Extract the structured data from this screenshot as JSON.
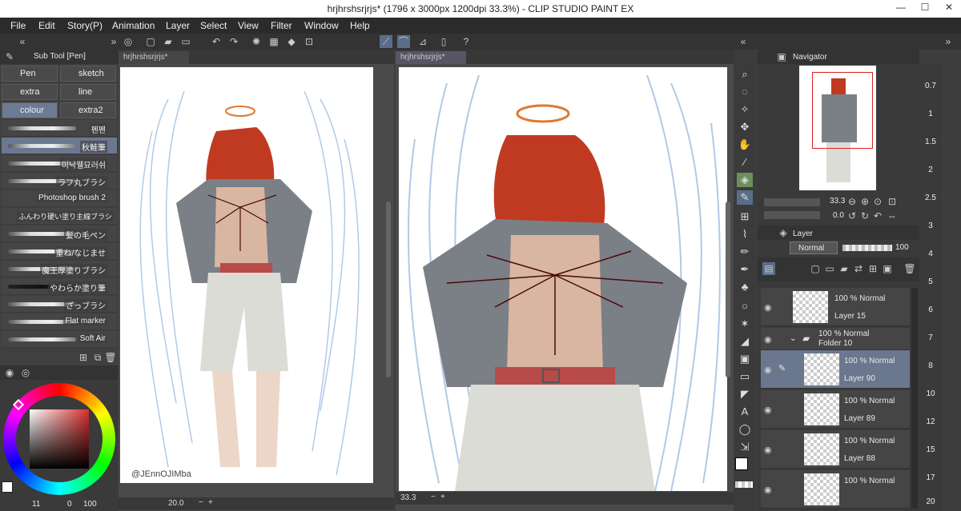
{
  "window": {
    "title": "hrjhrshsrjrjs* (1796 x 3000px 1200dpi 33.3%) - CLIP STUDIO PAINT EX",
    "minimize": "—",
    "maximize": "☐",
    "close": "✕"
  },
  "menu": [
    "File",
    "Edit",
    "Story(P)",
    "Animation",
    "Layer",
    "Select",
    "View",
    "Filter",
    "Window",
    "Help"
  ],
  "subtool": {
    "header": "Sub Tool [Pen]",
    "groups": [
      "Pen",
      "sketch",
      "extra",
      "line",
      "colour",
      "extra2"
    ],
    "selected_group": "colour",
    "brushes": [
      "펜펜",
      "秋鮭筆",
      "미낙웰묘러쉬",
      "ラフ丸ブラシ",
      "Photoshop brush 2",
      "ふんわり硬い塗り主線ブラシ",
      "髪の毛ペン",
      "重ね/なじませ",
      "魔王厚塗りブラシ",
      "やわらか塗り筆",
      "ざっブラシ",
      "Flat marker",
      "Soft Air"
    ],
    "selected_brush": "秋鮭筆"
  },
  "color": {
    "size_a": "11",
    "opacity": "0",
    "value": "100"
  },
  "canvas_left": {
    "tab": "hrjhrshsrjrjs*",
    "zoom": "20.0",
    "watermark": "@JEnnOJIMba"
  },
  "canvas_right": {
    "tab": "hrjhrshsrjrjs*",
    "zoom": "33.3"
  },
  "navigator": {
    "title": "Navigator",
    "zoom": "33.3",
    "angle": "0.0"
  },
  "layer_panel": {
    "title": "Layer",
    "blend": "Normal",
    "opacity": "100",
    "layers": [
      {
        "mode": "100 % Normal",
        "name": "Layer 15"
      },
      {
        "mode": "100 % Normal",
        "name": "Folder 10",
        "folder": true
      },
      {
        "mode": "100 % Normal",
        "name": "Layer 90",
        "selected": true
      },
      {
        "mode": "100 % Normal",
        "name": "Layer 89"
      },
      {
        "mode": "100 % Normal",
        "name": "Layer 88"
      },
      {
        "mode": "100 % Normal",
        "name": ""
      }
    ]
  },
  "zoom_list": [
    "0.7",
    "1",
    "1.5",
    "2",
    "2.5",
    "3",
    "4",
    "5",
    "6",
    "7",
    "8",
    "10",
    "12",
    "15",
    "17",
    "20"
  ],
  "colors": {
    "accent": "#6b7891",
    "tool_selected": "#6c8f5c",
    "nav_frame": "#e02020"
  }
}
